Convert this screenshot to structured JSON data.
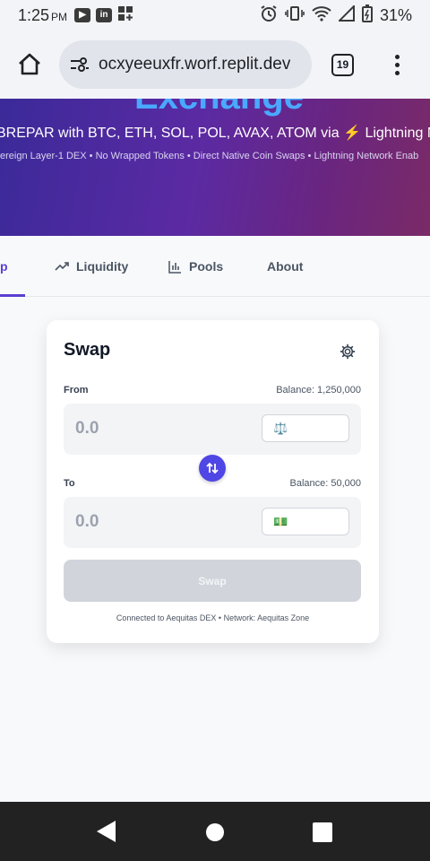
{
  "status_bar": {
    "time": "1:25",
    "ampm": "PM",
    "battery": "31%"
  },
  "browser": {
    "url": "ocxyeeuxfr.worf.replit.dev",
    "tab_count": "19"
  },
  "hero": {
    "title": "Exchange",
    "subtitle": "BREPAR with BTC, ETH, SOL, POL, AVAX, ATOM via ⚡ Lightning Ne",
    "tagline": "ereign Layer-1 DEX • No Wrapped Tokens • Direct Native Coin Swaps • Lightning Network Enab"
  },
  "nav": {
    "tabs": [
      {
        "label": "p",
        "active": true
      },
      {
        "label": "Liquidity",
        "icon": "trending-up-icon"
      },
      {
        "label": "Pools",
        "icon": "bar-chart-icon"
      },
      {
        "label": "About"
      }
    ]
  },
  "swap_card": {
    "title": "Swap",
    "from": {
      "label": "From",
      "balance": "Balance: 1,250,000",
      "amount_placeholder": "0.0",
      "token_icon": "⚖️"
    },
    "to": {
      "label": "To",
      "balance": "Balance: 50,000",
      "amount_placeholder": "0.0",
      "token_icon": "💵"
    },
    "swap_button": "Swap",
    "footer": "Connected to Aequitas DEX • Network: Aequitas Zone"
  },
  "colors": {
    "accent": "#5b3fd1",
    "swap_direction_button": "#4f46e5",
    "hero_title": "#4aa8ff"
  }
}
